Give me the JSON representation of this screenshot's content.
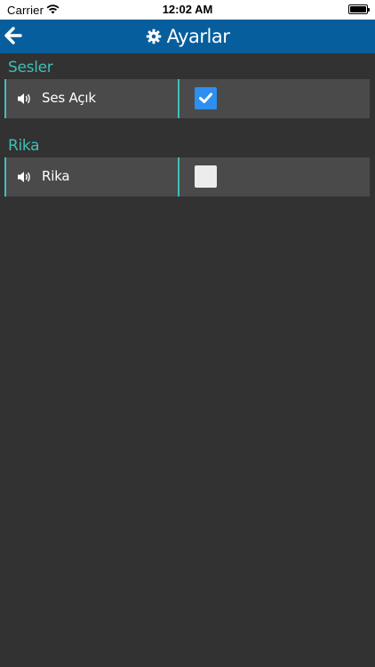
{
  "status_bar": {
    "carrier": "Carrier",
    "time": "12:02 AM",
    "wifi_icon": "wifi-icon",
    "battery_icon": "battery-icon"
  },
  "header": {
    "back_icon": "arrow-left-icon",
    "title_icon": "gear-icon",
    "title": "Ayarlar",
    "background_color": "#075e9c"
  },
  "sections": [
    {
      "title": "Sesler",
      "rows": [
        {
          "icon": "speaker-icon",
          "label": "Ses Açık",
          "checked": true
        }
      ]
    },
    {
      "title": "Rika",
      "rows": [
        {
          "icon": "speaker-icon",
          "label": "Rika",
          "checked": false
        }
      ]
    }
  ],
  "colors": {
    "accent": "#3fbfb8",
    "row_background": "#4a4a4a",
    "page_background": "#323232",
    "checkbox_checked": "#2d8ff0",
    "checkbox_unchecked": "#ececec"
  }
}
